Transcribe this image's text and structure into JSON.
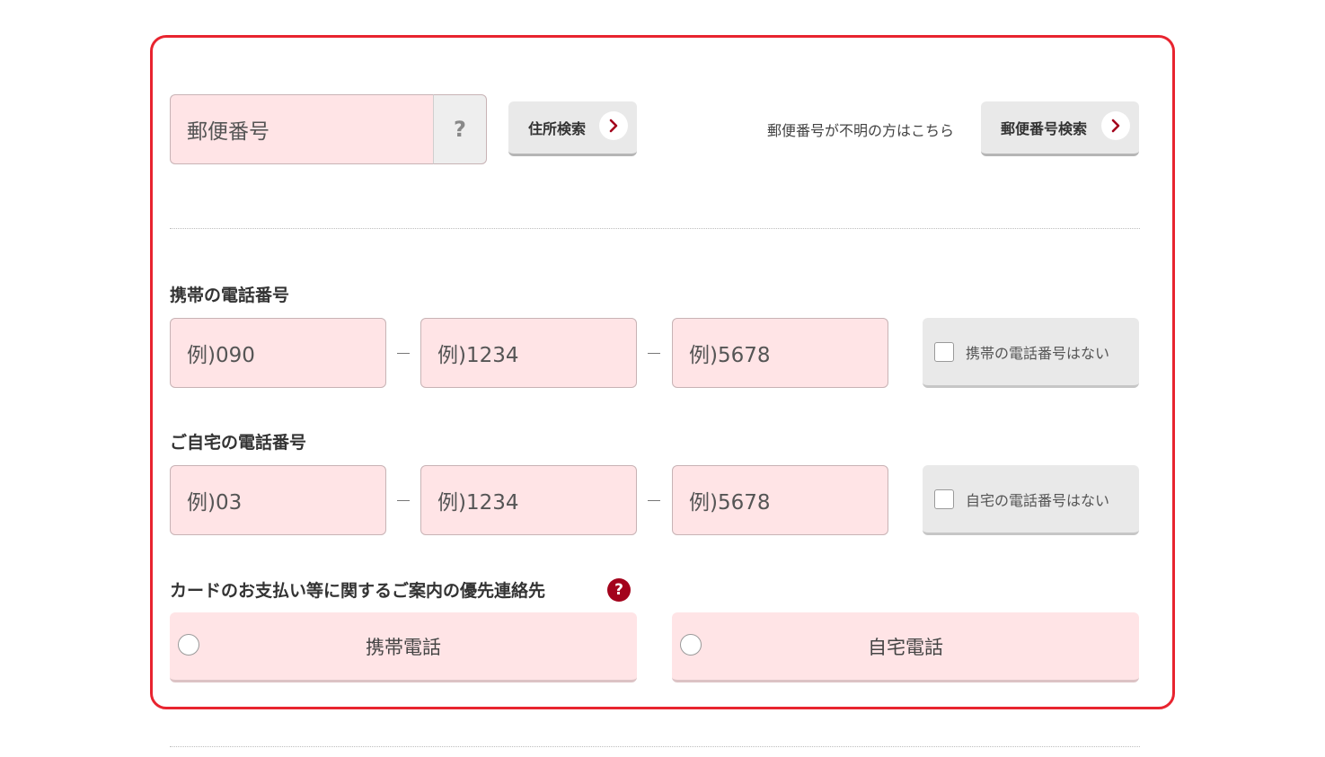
{
  "postal": {
    "placeholder": "郵便番号",
    "help_label": "?",
    "address_search_label": "住所検索",
    "unknown_note": "郵便番号が不明の方はこちら",
    "postal_search_label": "郵便番号検索"
  },
  "mobile": {
    "label": "携帯の電話番号",
    "part1_placeholder": "例)090",
    "part2_placeholder": "例)1234",
    "part3_placeholder": "例)5678",
    "separator": "–",
    "none_label": "携帯の電話番号はない"
  },
  "home": {
    "label": "ご自宅の電話番号",
    "part1_placeholder": "例)03",
    "part2_placeholder": "例)1234",
    "part3_placeholder": "例)5678",
    "separator": "–",
    "none_label": "自宅の電話番号はない"
  },
  "contact": {
    "label": "カードのお支払い等に関するご案内の優先連絡先",
    "help_label": "?",
    "options": [
      {
        "label": "携帯電話"
      },
      {
        "label": "自宅電話"
      }
    ]
  },
  "colors": {
    "frame": "#e8242f",
    "field_bg": "#ffe4e6",
    "button_bg": "#e9e9e9",
    "accent": "#a3031c"
  },
  "icons": {
    "chevron": "chevron-right-icon",
    "help": "question-icon"
  }
}
